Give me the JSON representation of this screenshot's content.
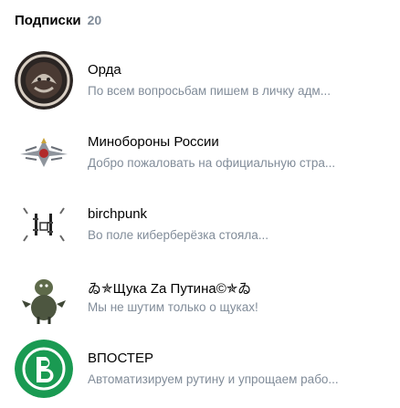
{
  "header": {
    "title": "Подписки",
    "count": "20"
  },
  "subscriptions": [
    {
      "name": "Орда",
      "description": "По всем вопросьбам пишем в личку адм...",
      "avatar_icon": "horde-emblem-icon",
      "avatar_color": "#3b2e2a"
    },
    {
      "name": "Минобороны России",
      "description": "Добро пожаловать на официальную стра...",
      "avatar_icon": "eagle-emblem-icon",
      "avatar_color": "#c9cdd4"
    },
    {
      "name": "birchpunk",
      "description": "Во поле киберберёзка стояла...",
      "avatar_icon": "birchpunk-logo-icon",
      "avatar_color": "#ffffff"
    },
    {
      "name": "ゐ✯Щука Za Путина©✯ゐ",
      "description": "Мы не шутим только о щуках!",
      "avatar_icon": "fish-character-icon",
      "avatar_color": "#6a6f5a"
    },
    {
      "name": "ВПОСТЕР",
      "description": "Автоматизируем рутину и упрощаем рабо...",
      "avatar_icon": "letter-b-logo-icon",
      "avatar_color": "#1a9a52"
    }
  ]
}
